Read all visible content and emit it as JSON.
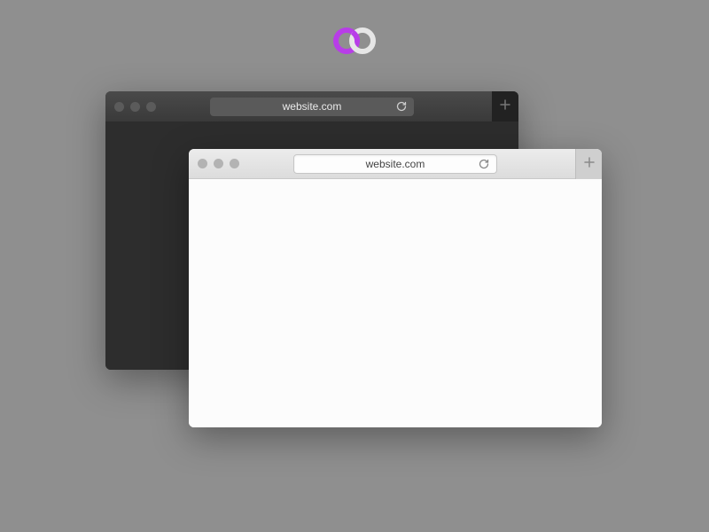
{
  "logo": {
    "ring1_color": "#b83de8",
    "ring2_color": "#e6e6e6"
  },
  "dark_window": {
    "url": "website.com"
  },
  "light_window": {
    "url": "website.com"
  }
}
